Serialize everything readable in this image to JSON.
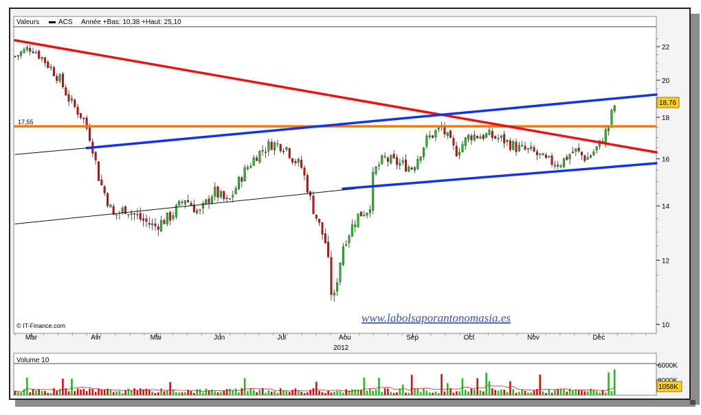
{
  "header": {
    "label": "Valeurs",
    "symbol": "ACS",
    "range_text": "Année +Bas: 10,38 +Haut: 25,10"
  },
  "copyright": "© IT-Finance.com",
  "watermark": "www.labolsaporantonomasia.es",
  "x_months": [
    "Mar",
    "Avr",
    "Mai",
    "Jun",
    "Jul",
    "Aou",
    "Sep",
    "Oct",
    "Nov",
    "Dec"
  ],
  "x_year": "2012",
  "price_ticks": [
    "22",
    "20",
    "18",
    "16",
    "14",
    "12",
    "10"
  ],
  "volume_title": "Volume 10",
  "volume_ticks": [
    "6000K",
    "3000K"
  ],
  "last_price_label": "18,76",
  "last_volume_label": "1058K",
  "support_label": "17,55",
  "colors": {
    "up": "#22bb22",
    "down": "#cc1111",
    "red_line": "#ee1111",
    "blue_line": "#1133ee",
    "orange_line": "#ff7700",
    "last_box": "#ffd020"
  },
  "chart_data": {
    "type": "candlestick",
    "title": "ACS",
    "ylim": [
      10,
      23
    ],
    "volume_ylim": [
      0,
      6000
    ],
    "volume_unit": "K",
    "support_level": 17.55,
    "last_price": 18.76,
    "last_volume_k": 1058,
    "year_low": 10.38,
    "year_high": 25.1,
    "trendlines": [
      {
        "name": "red_resistance",
        "from": [
          "2012-02-22",
          22.4
        ],
        "to": [
          "2012-12-31",
          16.3
        ]
      },
      {
        "name": "blue_channel_upper",
        "from": [
          "2012-03-28",
          16.5
        ],
        "to": [
          "2012-12-31",
          19.2
        ]
      },
      {
        "name": "blue_channel_lower",
        "from": [
          "2012-07-31",
          14.7
        ],
        "to": [
          "2012-12-31",
          15.8
        ]
      },
      {
        "name": "black_long_term",
        "from": [
          "2012-02-22",
          13.3
        ],
        "to": [
          "2012-08-06",
          14.7
        ]
      },
      {
        "name": "black_upper_extension",
        "from": [
          "2012-02-22",
          16.2
        ],
        "to": [
          "2012-03-28",
          16.5
        ]
      }
    ],
    "close_path": [
      [
        "2012-02-22",
        21.4
      ],
      [
        "2012-03-01",
        22.0
      ],
      [
        "2012-03-07",
        21.2
      ],
      [
        "2012-03-14",
        20.2
      ],
      [
        "2012-03-20",
        18.8
      ],
      [
        "2012-03-26",
        18.0
      ],
      [
        "2012-03-30",
        16.9
      ],
      [
        "2012-04-03",
        15.1
      ],
      [
        "2012-04-10",
        13.6
      ],
      [
        "2012-04-16",
        13.9
      ],
      [
        "2012-04-23",
        13.5
      ],
      [
        "2012-04-30",
        13.2
      ],
      [
        "2012-05-08",
        13.6
      ],
      [
        "2012-05-15",
        14.3
      ],
      [
        "2012-05-22",
        13.7
      ],
      [
        "2012-05-29",
        14.6
      ],
      [
        "2012-06-05",
        14.1
      ],
      [
        "2012-06-12",
        15.3
      ],
      [
        "2012-06-19",
        16.2
      ],
      [
        "2012-06-26",
        16.7
      ],
      [
        "2012-07-03",
        16.6
      ],
      [
        "2012-07-06",
        16.1
      ],
      [
        "2012-07-11",
        15.6
      ],
      [
        "2012-07-16",
        14.0
      ],
      [
        "2012-07-23",
        12.5
      ],
      [
        "2012-07-26",
        10.5
      ],
      [
        "2012-07-31",
        12.5
      ],
      [
        "2012-08-07",
        13.6
      ],
      [
        "2012-08-13",
        13.9
      ],
      [
        "2012-08-15",
        15.4
      ],
      [
        "2012-08-20",
        16.0
      ],
      [
        "2012-08-27",
        15.8
      ],
      [
        "2012-09-03",
        15.6
      ],
      [
        "2012-09-10",
        16.9
      ],
      [
        "2012-09-17",
        17.5
      ],
      [
        "2012-09-24",
        16.3
      ],
      [
        "2012-10-01",
        17.1
      ],
      [
        "2012-10-10",
        17.1
      ],
      [
        "2012-10-17",
        16.9
      ],
      [
        "2012-10-24",
        16.5
      ],
      [
        "2012-11-01",
        16.3
      ],
      [
        "2012-11-07",
        15.9
      ],
      [
        "2012-11-14",
        15.8
      ],
      [
        "2012-11-21",
        16.4
      ],
      [
        "2012-11-27",
        16.0
      ],
      [
        "2012-12-03",
        16.6
      ],
      [
        "2012-12-07",
        17.4
      ],
      [
        "2012-12-11",
        18.76
      ]
    ]
  }
}
